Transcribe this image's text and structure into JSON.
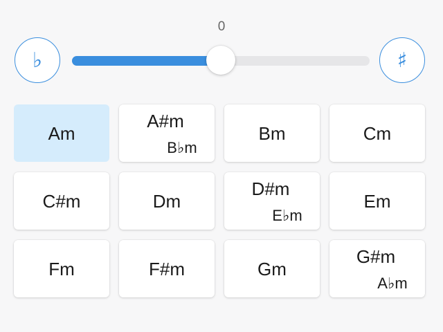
{
  "transpose": {
    "value": "0",
    "position": 0.5,
    "flat_label": "♭",
    "sharp_label": "♯",
    "accent_color": "#3a8ede"
  },
  "chords": [
    {
      "label": "Am",
      "alt": "",
      "selected": true
    },
    {
      "label": "A#m",
      "alt": "B♭m",
      "selected": false
    },
    {
      "label": "Bm",
      "alt": "",
      "selected": false
    },
    {
      "label": "Cm",
      "alt": "",
      "selected": false
    },
    {
      "label": "C#m",
      "alt": "",
      "selected": false
    },
    {
      "label": "Dm",
      "alt": "",
      "selected": false
    },
    {
      "label": "D#m",
      "alt": "E♭m",
      "selected": false
    },
    {
      "label": "Em",
      "alt": "",
      "selected": false
    },
    {
      "label": "Fm",
      "alt": "",
      "selected": false
    },
    {
      "label": "F#m",
      "alt": "",
      "selected": false
    },
    {
      "label": "Gm",
      "alt": "",
      "selected": false
    },
    {
      "label": "G#m",
      "alt": "A♭m",
      "selected": false
    }
  ],
  "selected_color": "#d5ecfc"
}
